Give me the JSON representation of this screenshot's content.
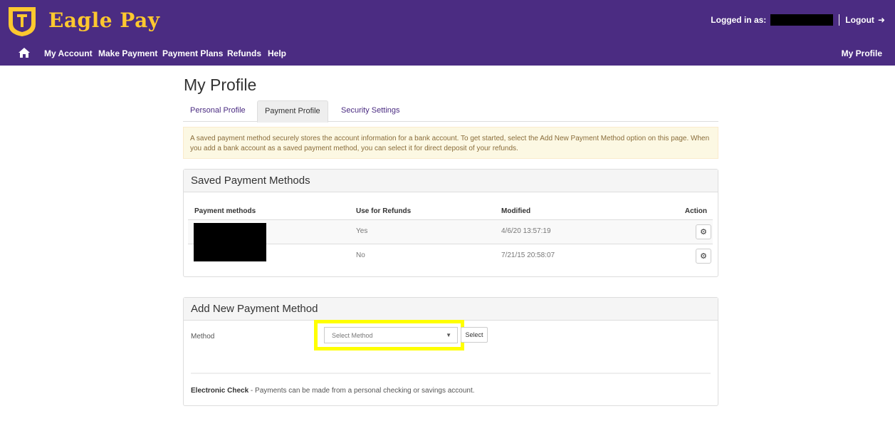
{
  "header": {
    "brand": "Eagle Pay",
    "logged_in_label": "Logged in as:",
    "logout_label": "Logout",
    "colors": {
      "bar": "#4b2c82",
      "brand_text": "#fdc82f"
    }
  },
  "nav": {
    "items": [
      "My Account",
      "Make Payment",
      "Payment Plans",
      "Refunds",
      "Help"
    ],
    "right": "My Profile"
  },
  "page": {
    "title": "My Profile",
    "tabs": [
      "Personal Profile",
      "Payment Profile",
      "Security Settings"
    ],
    "active_tab": "Payment Profile",
    "alert": "A saved payment method securely stores the account information for a bank account. To get started, select the Add New Payment Method option on this page. When you add a bank account as a saved payment method, you can select it for direct deposit of your refunds."
  },
  "saved": {
    "heading": "Saved Payment Methods",
    "columns": [
      "Payment methods",
      "Use for Refunds",
      "Modified",
      "Action"
    ],
    "rows": [
      {
        "refunds": "Yes",
        "modified": "4/6/20 13:57:19"
      },
      {
        "refunds": "No",
        "modified": "7/21/15 20:58:07"
      }
    ]
  },
  "add": {
    "heading": "Add New Payment Method",
    "method_label": "Method",
    "select_value": "Select Method",
    "select_button": "Select",
    "footnote_bold": "Electronic Check",
    "footnote_text": " - Payments can be made from a personal checking or savings account."
  }
}
